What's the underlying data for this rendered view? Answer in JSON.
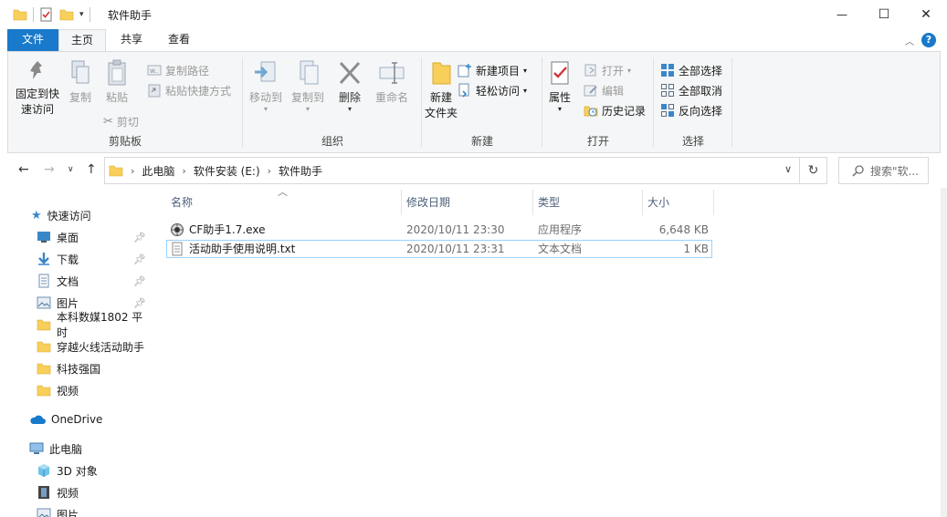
{
  "window": {
    "title": "软件助手",
    "controls": {
      "minimize": "—",
      "maximize": "☐",
      "close": "✕"
    }
  },
  "ribbon_tabs": [
    {
      "label": "文件"
    },
    {
      "label": "主页"
    },
    {
      "label": "共享"
    },
    {
      "label": "查看"
    }
  ],
  "ribbon": {
    "clipboard": {
      "pin_quick_access": "固定到快速访问",
      "pin_line1": "固定到快",
      "pin_line2": "速访问",
      "copy": "复制",
      "paste": "粘贴",
      "copy_path": "复制路径",
      "paste_shortcut": "粘贴快捷方式",
      "cut": "剪切",
      "group_label": "剪贴板"
    },
    "organize": {
      "move_to": "移动到",
      "copy_to": "复制到",
      "delete": "删除",
      "rename": "重命名",
      "group_label": "组织"
    },
    "new": {
      "new_folder_line1": "新建",
      "new_folder_line2": "文件夹",
      "new_item": "新建项目",
      "easy_access": "轻松访问",
      "group_label": "新建"
    },
    "open": {
      "properties": "属性",
      "open": "打开",
      "edit": "编辑",
      "history": "历史记录",
      "group_label": "打开"
    },
    "select": {
      "select_all": "全部选择",
      "select_none": "全部取消",
      "invert": "反向选择",
      "group_label": "选择"
    }
  },
  "address_bar": {
    "breadcrumbs": [
      "此电脑",
      "软件安装 (E:)",
      "软件助手"
    ],
    "search_placeholder": "搜索\"软..."
  },
  "nav_pane": {
    "quick_access": "快速访问",
    "items": [
      {
        "label": "桌面",
        "pinned": true
      },
      {
        "label": "下载",
        "pinned": true
      },
      {
        "label": "文档",
        "pinned": true
      },
      {
        "label": "图片",
        "pinned": true
      },
      {
        "label": "本科数媒1802 平时",
        "pinned": false
      },
      {
        "label": "穿越火线活动助手",
        "pinned": false
      },
      {
        "label": "科技强国",
        "pinned": false
      },
      {
        "label": "视频",
        "pinned": false
      }
    ],
    "onedrive": "OneDrive",
    "this_pc": "此电脑",
    "pc_items": [
      {
        "label": "3D 对象"
      },
      {
        "label": "视频"
      },
      {
        "label": "图片"
      }
    ]
  },
  "file_list": {
    "columns": [
      "名称",
      "修改日期",
      "类型",
      "大小"
    ],
    "rows": [
      {
        "name": "CF助手1.7.exe",
        "modified": "2020/10/11 23:30",
        "type": "应用程序",
        "size": "6,648 KB"
      },
      {
        "name": "活动助手使用说明.txt",
        "modified": "2020/10/11 23:31",
        "type": "文本文档",
        "size": "1 KB"
      }
    ]
  },
  "colors": {
    "file_tab": "#1979ca",
    "selection_border": "#99d1ff",
    "ribbon_bg": "#f5f6f7",
    "folder_yellow": "#f7cf5a"
  }
}
